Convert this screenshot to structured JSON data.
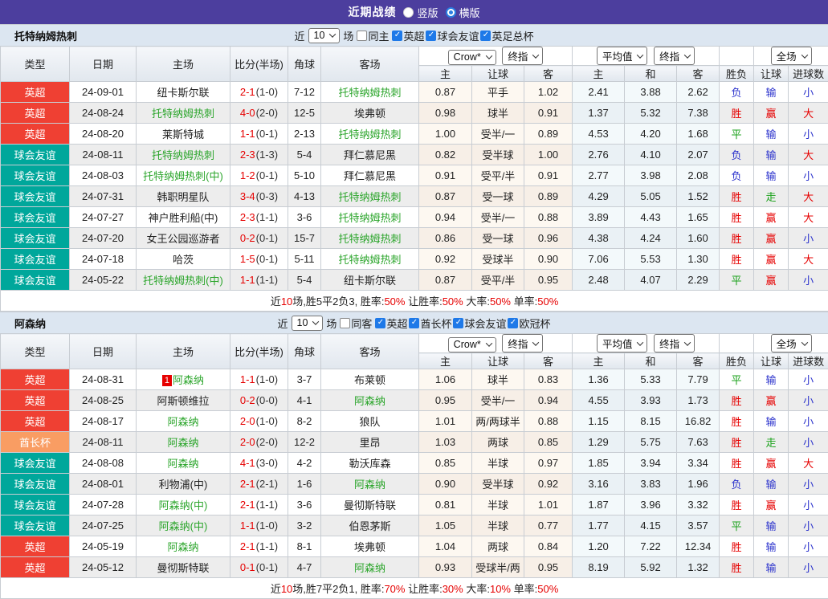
{
  "title_bar": {
    "title": "近期战绩",
    "radios": [
      {
        "label": "竖版",
        "checked": false
      },
      {
        "label": "横版",
        "checked": true
      }
    ]
  },
  "icons": {
    "check": "✓"
  },
  "colors": {
    "titlebar_bg": "#4c3e9e",
    "filterbar_bg": "#dce6f1",
    "checkbox_checked": "#1e79e8",
    "type": {
      "英超": "#ef4033",
      "球会友谊": "#00a79b",
      "酋长杯": "#f99d63"
    },
    "self_team": "#2ba52b",
    "score_ft": "#e60000",
    "result": {
      "red": "#e60000",
      "blue": "#2b32cc",
      "green": "#1ba11b"
    },
    "summary_highlight": "#e60000"
  },
  "table_header": {
    "static_cols": [
      "类型",
      "日期",
      "主场",
      "比分(半场)",
      "角球",
      "客场"
    ],
    "sub_cols_ah": [
      "主",
      "让球",
      "客"
    ],
    "sub_cols_eu": [
      "主",
      "和",
      "客"
    ],
    "result_cols": [
      "胜负",
      "让球",
      "进球数"
    ],
    "dropdowns": {
      "ah_source": "Crow*",
      "ah_time": "终指",
      "eu_source": "平均值",
      "eu_time": "终指",
      "scope": "全场"
    }
  },
  "teams": [
    {
      "name": "托特纳姆热刺",
      "filter": {
        "near": "近",
        "games": "10",
        "unit": "场",
        "same": {
          "label": "同主",
          "checked": false
        },
        "leagues": [
          {
            "label": "英超",
            "checked": true
          },
          {
            "label": "球会友谊",
            "checked": true
          },
          {
            "label": "英足总杯",
            "checked": true
          }
        ]
      },
      "rows": [
        {
          "type": "英超",
          "date": "24-09-01",
          "rank": "",
          "home": "纽卡斯尔联",
          "home_self": false,
          "score": "2-1",
          "half": "(1-0)",
          "corner": "7-12",
          "away": "托特纳姆热刺",
          "away_self": true,
          "ah": [
            "0.87",
            "平手",
            "1.02"
          ],
          "eu": [
            "2.41",
            "3.88",
            "2.62"
          ],
          "res": [
            {
              "t": "负",
              "c": "blue"
            },
            {
              "t": "输",
              "c": "blue"
            },
            {
              "t": "小",
              "c": "blue"
            }
          ]
        },
        {
          "type": "英超",
          "date": "24-08-24",
          "rank": "",
          "home": "托特纳姆热刺",
          "home_self": true,
          "score": "4-0",
          "half": "(2-0)",
          "corner": "12-5",
          "away": "埃弗顿",
          "away_self": false,
          "ah": [
            "0.98",
            "球半",
            "0.91"
          ],
          "eu": [
            "1.37",
            "5.32",
            "7.38"
          ],
          "res": [
            {
              "t": "胜",
              "c": "red"
            },
            {
              "t": "赢",
              "c": "red"
            },
            {
              "t": "大",
              "c": "red"
            }
          ]
        },
        {
          "type": "英超",
          "date": "24-08-20",
          "rank": "",
          "home": "莱斯特城",
          "home_self": false,
          "score": "1-1",
          "half": "(0-1)",
          "corner": "2-13",
          "away": "托特纳姆热刺",
          "away_self": true,
          "ah": [
            "1.00",
            "受半/一",
            "0.89"
          ],
          "eu": [
            "4.53",
            "4.20",
            "1.68"
          ],
          "res": [
            {
              "t": "平",
              "c": "green"
            },
            {
              "t": "输",
              "c": "blue"
            },
            {
              "t": "小",
              "c": "blue"
            }
          ]
        },
        {
          "type": "球会友谊",
          "date": "24-08-11",
          "rank": "",
          "home": "托特纳姆热刺",
          "home_self": true,
          "score": "2-3",
          "half": "(1-3)",
          "corner": "5-4",
          "away": "拜仁慕尼黑",
          "away_self": false,
          "ah": [
            "0.82",
            "受半球",
            "1.00"
          ],
          "eu": [
            "2.76",
            "4.10",
            "2.07"
          ],
          "res": [
            {
              "t": "负",
              "c": "blue"
            },
            {
              "t": "输",
              "c": "blue"
            },
            {
              "t": "大",
              "c": "red"
            }
          ]
        },
        {
          "type": "球会友谊",
          "date": "24-08-03",
          "rank": "",
          "home": "托特纳姆热刺(中)",
          "home_self": true,
          "score": "1-2",
          "half": "(0-1)",
          "corner": "5-10",
          "away": "拜仁慕尼黑",
          "away_self": false,
          "ah": [
            "0.91",
            "受平/半",
            "0.91"
          ],
          "eu": [
            "2.77",
            "3.98",
            "2.08"
          ],
          "res": [
            {
              "t": "负",
              "c": "blue"
            },
            {
              "t": "输",
              "c": "blue"
            },
            {
              "t": "小",
              "c": "blue"
            }
          ]
        },
        {
          "type": "球会友谊",
          "date": "24-07-31",
          "rank": "",
          "home": "韩职明星队",
          "home_self": false,
          "score": "3-4",
          "half": "(0-3)",
          "corner": "4-13",
          "away": "托特纳姆热刺",
          "away_self": true,
          "ah": [
            "0.87",
            "受一球",
            "0.89"
          ],
          "eu": [
            "4.29",
            "5.05",
            "1.52"
          ],
          "res": [
            {
              "t": "胜",
              "c": "red"
            },
            {
              "t": "走",
              "c": "green"
            },
            {
              "t": "大",
              "c": "red"
            }
          ]
        },
        {
          "type": "球会友谊",
          "date": "24-07-27",
          "rank": "",
          "home": "神户胜利船(中)",
          "home_self": false,
          "score": "2-3",
          "half": "(1-1)",
          "corner": "3-6",
          "away": "托特纳姆热刺",
          "away_self": true,
          "ah": [
            "0.94",
            "受半/一",
            "0.88"
          ],
          "eu": [
            "3.89",
            "4.43",
            "1.65"
          ],
          "res": [
            {
              "t": "胜",
              "c": "red"
            },
            {
              "t": "赢",
              "c": "red"
            },
            {
              "t": "大",
              "c": "red"
            }
          ]
        },
        {
          "type": "球会友谊",
          "date": "24-07-20",
          "rank": "",
          "home": "女王公园巡游者",
          "home_self": false,
          "score": "0-2",
          "half": "(0-1)",
          "corner": "15-7",
          "away": "托特纳姆热刺",
          "away_self": true,
          "ah": [
            "0.86",
            "受一球",
            "0.96"
          ],
          "eu": [
            "4.38",
            "4.24",
            "1.60"
          ],
          "res": [
            {
              "t": "胜",
              "c": "red"
            },
            {
              "t": "赢",
              "c": "red"
            },
            {
              "t": "小",
              "c": "blue"
            }
          ]
        },
        {
          "type": "球会友谊",
          "date": "24-07-18",
          "rank": "",
          "home": "哈茨",
          "home_self": false,
          "score": "1-5",
          "half": "(0-1)",
          "corner": "5-11",
          "away": "托特纳姆热刺",
          "away_self": true,
          "ah": [
            "0.92",
            "受球半",
            "0.90"
          ],
          "eu": [
            "7.06",
            "5.53",
            "1.30"
          ],
          "res": [
            {
              "t": "胜",
              "c": "red"
            },
            {
              "t": "赢",
              "c": "red"
            },
            {
              "t": "大",
              "c": "red"
            }
          ]
        },
        {
          "type": "球会友谊",
          "date": "24-05-22",
          "rank": "",
          "home": "托特纳姆热刺(中)",
          "home_self": true,
          "score": "1-1",
          "half": "(1-1)",
          "corner": "5-4",
          "away": "纽卡斯尔联",
          "away_self": false,
          "ah": [
            "0.87",
            "受平/半",
            "0.95"
          ],
          "eu": [
            "2.48",
            "4.07",
            "2.29"
          ],
          "res": [
            {
              "t": "平",
              "c": "green"
            },
            {
              "t": "赢",
              "c": "red"
            },
            {
              "t": "小",
              "c": "blue"
            }
          ]
        }
      ],
      "summary": [
        [
          "近",
          "k"
        ],
        [
          "10",
          "r"
        ],
        [
          "场,胜5平2负3, 胜率:",
          "k"
        ],
        [
          "50%",
          "r"
        ],
        [
          " 让胜率:",
          "k"
        ],
        [
          "50%",
          "r"
        ],
        [
          " 大率:",
          "k"
        ],
        [
          "50%",
          "r"
        ],
        [
          " 单率:",
          "k"
        ],
        [
          "50%",
          "r"
        ]
      ]
    },
    {
      "name": "阿森纳",
      "filter": {
        "near": "近",
        "games": "10",
        "unit": "场",
        "same": {
          "label": "同客",
          "checked": false
        },
        "leagues": [
          {
            "label": "英超",
            "checked": true
          },
          {
            "label": "酋长杯",
            "checked": true
          },
          {
            "label": "球会友谊",
            "checked": true
          },
          {
            "label": "欧冠杯",
            "checked": true
          }
        ]
      },
      "rows": [
        {
          "type": "英超",
          "date": "24-08-31",
          "rank": "1",
          "home": "阿森纳",
          "home_self": true,
          "score": "1-1",
          "half": "(1-0)",
          "corner": "3-7",
          "away": "布莱顿",
          "away_self": false,
          "ah": [
            "1.06",
            "球半",
            "0.83"
          ],
          "eu": [
            "1.36",
            "5.33",
            "7.79"
          ],
          "res": [
            {
              "t": "平",
              "c": "green"
            },
            {
              "t": "输",
              "c": "blue"
            },
            {
              "t": "小",
              "c": "blue"
            }
          ]
        },
        {
          "type": "英超",
          "date": "24-08-25",
          "rank": "",
          "home": "阿斯顿维拉",
          "home_self": false,
          "score": "0-2",
          "half": "(0-0)",
          "corner": "4-1",
          "away": "阿森纳",
          "away_self": true,
          "ah": [
            "0.95",
            "受半/一",
            "0.94"
          ],
          "eu": [
            "4.55",
            "3.93",
            "1.73"
          ],
          "res": [
            {
              "t": "胜",
              "c": "red"
            },
            {
              "t": "赢",
              "c": "red"
            },
            {
              "t": "小",
              "c": "blue"
            }
          ]
        },
        {
          "type": "英超",
          "date": "24-08-17",
          "rank": "",
          "home": "阿森纳",
          "home_self": true,
          "score": "2-0",
          "half": "(1-0)",
          "corner": "8-2",
          "away": "狼队",
          "away_self": false,
          "ah": [
            "1.01",
            "两/两球半",
            "0.88"
          ],
          "eu": [
            "1.15",
            "8.15",
            "16.82"
          ],
          "res": [
            {
              "t": "胜",
              "c": "red"
            },
            {
              "t": "输",
              "c": "blue"
            },
            {
              "t": "小",
              "c": "blue"
            }
          ]
        },
        {
          "type": "酋长杯",
          "date": "24-08-11",
          "rank": "",
          "home": "阿森纳",
          "home_self": true,
          "score": "2-0",
          "half": "(2-0)",
          "corner": "12-2",
          "away": "里昂",
          "away_self": false,
          "ah": [
            "1.03",
            "两球",
            "0.85"
          ],
          "eu": [
            "1.29",
            "5.75",
            "7.63"
          ],
          "res": [
            {
              "t": "胜",
              "c": "red"
            },
            {
              "t": "走",
              "c": "green"
            },
            {
              "t": "小",
              "c": "blue"
            }
          ]
        },
        {
          "type": "球会友谊",
          "date": "24-08-08",
          "rank": "",
          "home": "阿森纳",
          "home_self": true,
          "score": "4-1",
          "half": "(3-0)",
          "corner": "4-2",
          "away": "勒沃库森",
          "away_self": false,
          "ah": [
            "0.85",
            "半球",
            "0.97"
          ],
          "eu": [
            "1.85",
            "3.94",
            "3.34"
          ],
          "res": [
            {
              "t": "胜",
              "c": "red"
            },
            {
              "t": "赢",
              "c": "red"
            },
            {
              "t": "大",
              "c": "red"
            }
          ]
        },
        {
          "type": "球会友谊",
          "date": "24-08-01",
          "rank": "",
          "home": "利物浦(中)",
          "home_self": false,
          "score": "2-1",
          "half": "(2-1)",
          "corner": "1-6",
          "away": "阿森纳",
          "away_self": true,
          "ah": [
            "0.90",
            "受半球",
            "0.92"
          ],
          "eu": [
            "3.16",
            "3.83",
            "1.96"
          ],
          "res": [
            {
              "t": "负",
              "c": "blue"
            },
            {
              "t": "输",
              "c": "blue"
            },
            {
              "t": "小",
              "c": "blue"
            }
          ]
        },
        {
          "type": "球会友谊",
          "date": "24-07-28",
          "rank": "",
          "home": "阿森纳(中)",
          "home_self": true,
          "score": "2-1",
          "half": "(1-1)",
          "corner": "3-6",
          "away": "曼彻斯特联",
          "away_self": false,
          "ah": [
            "0.81",
            "半球",
            "1.01"
          ],
          "eu": [
            "1.87",
            "3.96",
            "3.32"
          ],
          "res": [
            {
              "t": "胜",
              "c": "red"
            },
            {
              "t": "赢",
              "c": "red"
            },
            {
              "t": "小",
              "c": "blue"
            }
          ]
        },
        {
          "type": "球会友谊",
          "date": "24-07-25",
          "rank": "",
          "home": "阿森纳(中)",
          "home_self": true,
          "score": "1-1",
          "half": "(1-0)",
          "corner": "3-2",
          "away": "伯恩茅斯",
          "away_self": false,
          "ah": [
            "1.05",
            "半球",
            "0.77"
          ],
          "eu": [
            "1.77",
            "4.15",
            "3.57"
          ],
          "res": [
            {
              "t": "平",
              "c": "green"
            },
            {
              "t": "输",
              "c": "blue"
            },
            {
              "t": "小",
              "c": "blue"
            }
          ]
        },
        {
          "type": "英超",
          "date": "24-05-19",
          "rank": "",
          "home": "阿森纳",
          "home_self": true,
          "score": "2-1",
          "half": "(1-1)",
          "corner": "8-1",
          "away": "埃弗顿",
          "away_self": false,
          "ah": [
            "1.04",
            "两球",
            "0.84"
          ],
          "eu": [
            "1.20",
            "7.22",
            "12.34"
          ],
          "res": [
            {
              "t": "胜",
              "c": "red"
            },
            {
              "t": "输",
              "c": "blue"
            },
            {
              "t": "小",
              "c": "blue"
            }
          ]
        },
        {
          "type": "英超",
          "date": "24-05-12",
          "rank": "",
          "home": "曼彻斯特联",
          "home_self": false,
          "score": "0-1",
          "half": "(0-1)",
          "corner": "4-7",
          "away": "阿森纳",
          "away_self": true,
          "ah": [
            "0.93",
            "受球半/两",
            "0.95"
          ],
          "eu": [
            "8.19",
            "5.92",
            "1.32"
          ],
          "res": [
            {
              "t": "胜",
              "c": "red"
            },
            {
              "t": "输",
              "c": "blue"
            },
            {
              "t": "小",
              "c": "blue"
            }
          ]
        }
      ],
      "summary": [
        [
          "近",
          "k"
        ],
        [
          "10",
          "r"
        ],
        [
          "场,胜7平2负1, 胜率:",
          "k"
        ],
        [
          "70%",
          "r"
        ],
        [
          " 让胜率:",
          "k"
        ],
        [
          "30%",
          "r"
        ],
        [
          " 大率:",
          "k"
        ],
        [
          "10%",
          "r"
        ],
        [
          " 单率:",
          "k"
        ],
        [
          "50%",
          "r"
        ]
      ]
    }
  ]
}
